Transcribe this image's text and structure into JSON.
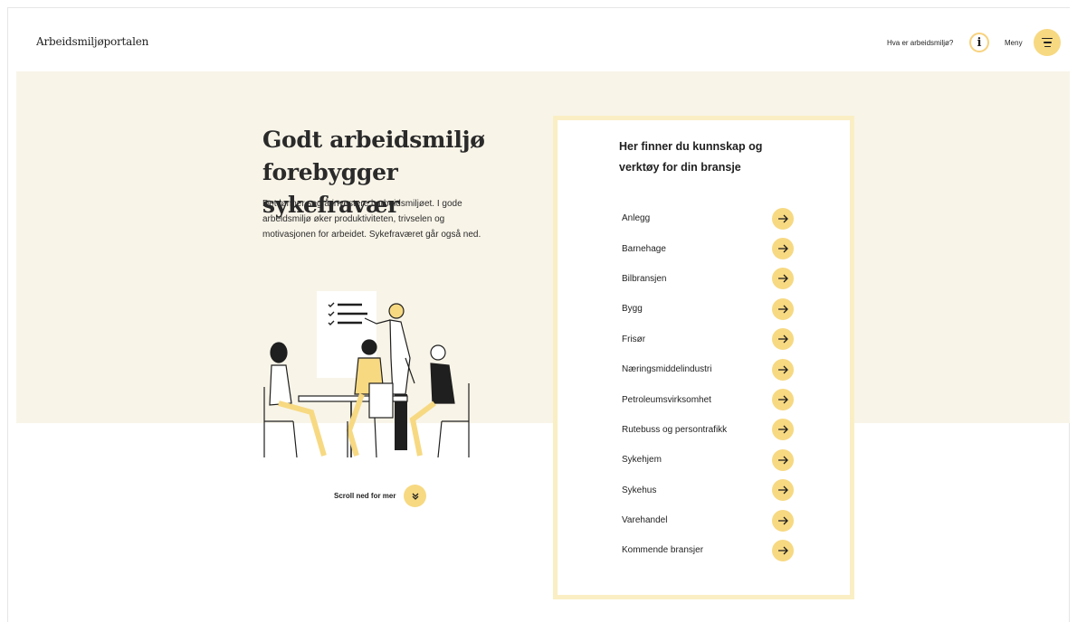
{
  "header": {
    "logo_text": "Arbeidsmiljøportalen",
    "info_link_label": "Hva er arbeidsmiljø?",
    "info_icon_glyph": "i",
    "menu_label": "Meny"
  },
  "hero": {
    "headline": "Godt arbeidsmiljø forebygger sykefravær",
    "intro": "Det lønner seg å investere i arbeidsmiljøet. I gode arbeidsmiljø øker produktiviteten, trivselen og motivasjonen for arbeidet. Sykefraværet går også ned.",
    "illustration_icon": "team-meeting-illustration",
    "scroll_label": "Scroll ned for mer"
  },
  "industries": {
    "title": "Her finner du kunnskap og verktøy for din bransje",
    "items": [
      {
        "label": "Anlegg"
      },
      {
        "label": "Barnehage"
      },
      {
        "label": "Bilbransjen"
      },
      {
        "label": "Bygg"
      },
      {
        "label": "Frisør"
      },
      {
        "label": "Næringsmiddelindustri"
      },
      {
        "label": "Petroleumsvirksomhet"
      },
      {
        "label": "Rutebuss og persontrafikk"
      },
      {
        "label": "Sykehjem"
      },
      {
        "label": "Sykehus"
      },
      {
        "label": "Varehandel"
      },
      {
        "label": "Kommende bransjer"
      }
    ]
  },
  "colors": {
    "accent": "#f7d982",
    "hero_background": "#f8f4e8",
    "panel_border": "#faeec4",
    "text": "#1f1f1f"
  }
}
